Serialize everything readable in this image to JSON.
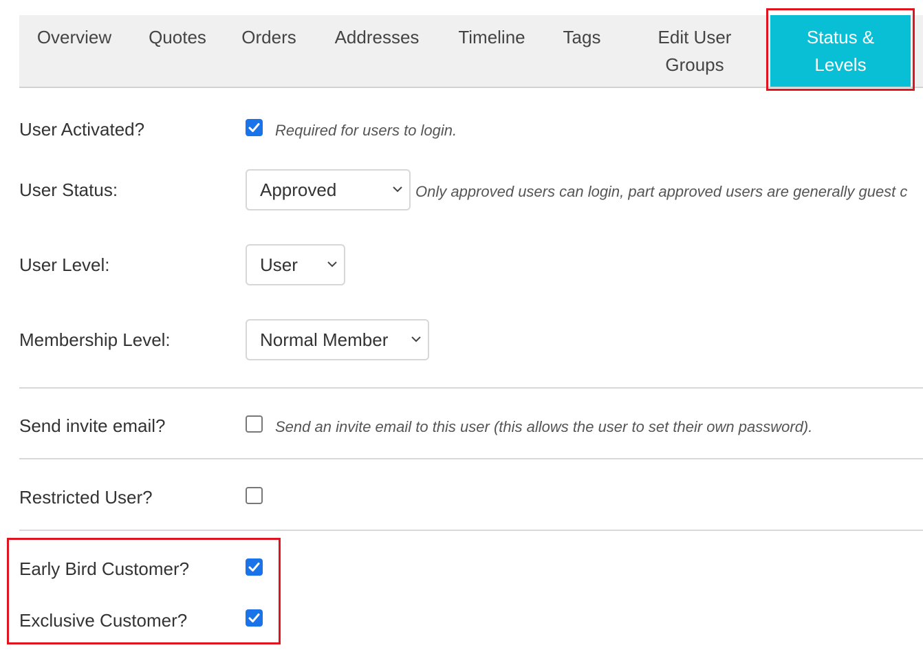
{
  "tabs": [
    {
      "label_line1": "Overview",
      "label_line2": ""
    },
    {
      "label_line1": "Quotes",
      "label_line2": ""
    },
    {
      "label_line1": "Orders",
      "label_line2": ""
    },
    {
      "label_line1": "Addresses",
      "label_line2": ""
    },
    {
      "label_line1": "Timeline",
      "label_line2": ""
    },
    {
      "label_line1": "Tags",
      "label_line2": ""
    },
    {
      "label_line1": "Edit User",
      "label_line2": "Groups"
    },
    {
      "label_line1": "Status &",
      "label_line2": "Levels"
    }
  ],
  "active_tab": "Status & Levels",
  "colors": {
    "accent": "#08bfd5",
    "highlight": "#e0141e",
    "checkbox": "#1a73e8"
  },
  "form": {
    "user_activated": {
      "label": "User Activated?",
      "checked": true,
      "hint": "Required for users to login."
    },
    "user_status": {
      "label": "User Status:",
      "value": "Approved",
      "hint": "Only approved users can login, part approved users are generally guest c"
    },
    "user_level": {
      "label": "User Level:",
      "value": "User"
    },
    "membership_level": {
      "label": "Membership Level:",
      "value": "Normal Member"
    },
    "send_invite": {
      "label": "Send invite email?",
      "checked": false,
      "hint": "Send an invite email to this user (this allows the user to set their own password)."
    },
    "restricted_user": {
      "label": "Restricted User?",
      "checked": false
    },
    "early_bird": {
      "label": "Early Bird Customer?",
      "checked": true
    },
    "exclusive": {
      "label": "Exclusive Customer?",
      "checked": true
    }
  }
}
